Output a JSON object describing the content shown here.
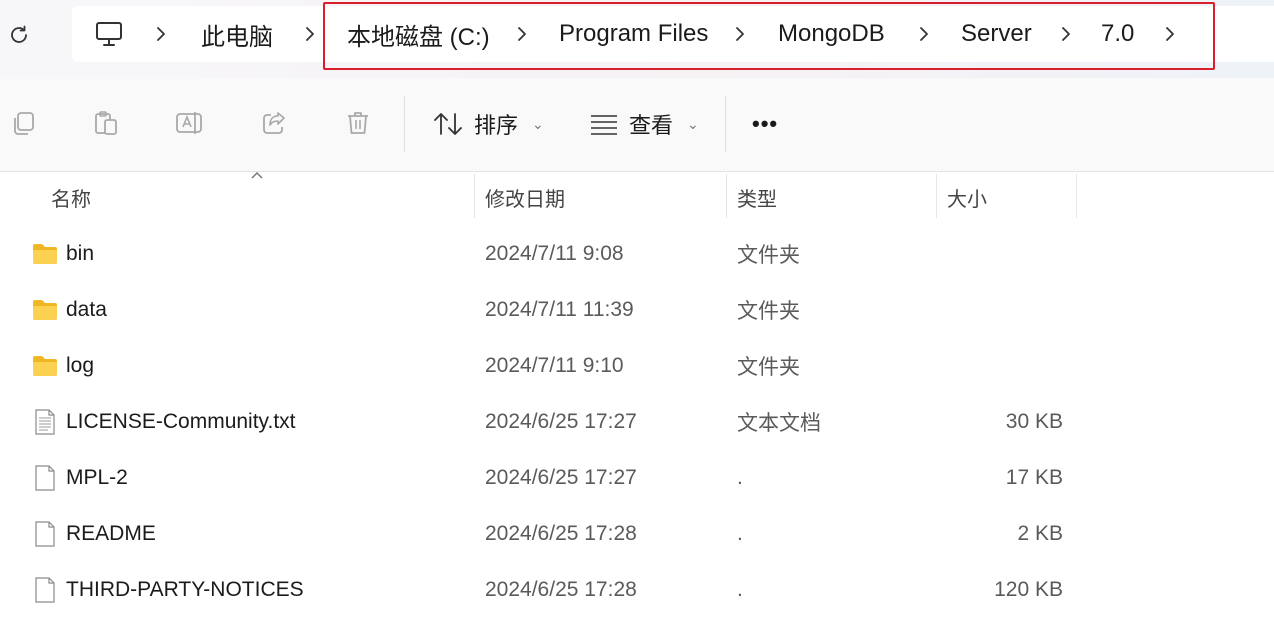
{
  "breadcrumb": {
    "computer_icon": "computer-icon",
    "items": [
      "此电脑",
      "本地磁盘 (C:)",
      "Program Files",
      "MongoDB",
      "Server",
      "7.0"
    ],
    "highlight_color": "#d7202c"
  },
  "toolbar": {
    "sort_label": "排序",
    "view_label": "查看",
    "more_label": "•••"
  },
  "columns": [
    "名称",
    "修改日期",
    "类型",
    "大小"
  ],
  "files": [
    {
      "name": "bin",
      "date": "2024/7/11 9:08",
      "type": "文件夹",
      "size": "",
      "icon": "folder-icon"
    },
    {
      "name": "data",
      "date": "2024/7/11 11:39",
      "type": "文件夹",
      "size": "",
      "icon": "folder-icon"
    },
    {
      "name": "log",
      "date": "2024/7/11 9:10",
      "type": "文件夹",
      "size": "",
      "icon": "folder-icon"
    },
    {
      "name": "LICENSE-Community.txt",
      "date": "2024/6/25 17:27",
      "type": "文本文档",
      "size": "30 KB",
      "icon": "text-file-icon"
    },
    {
      "name": "MPL-2",
      "date": "2024/6/25 17:27",
      "type": ".",
      "size": "17 KB",
      "icon": "file-icon"
    },
    {
      "name": "README",
      "date": "2024/6/25 17:28",
      "type": ".",
      "size": "2 KB",
      "icon": "file-icon"
    },
    {
      "name": "THIRD-PARTY-NOTICES",
      "date": "2024/6/25 17:28",
      "type": ".",
      "size": "120 KB",
      "icon": "file-icon"
    }
  ]
}
